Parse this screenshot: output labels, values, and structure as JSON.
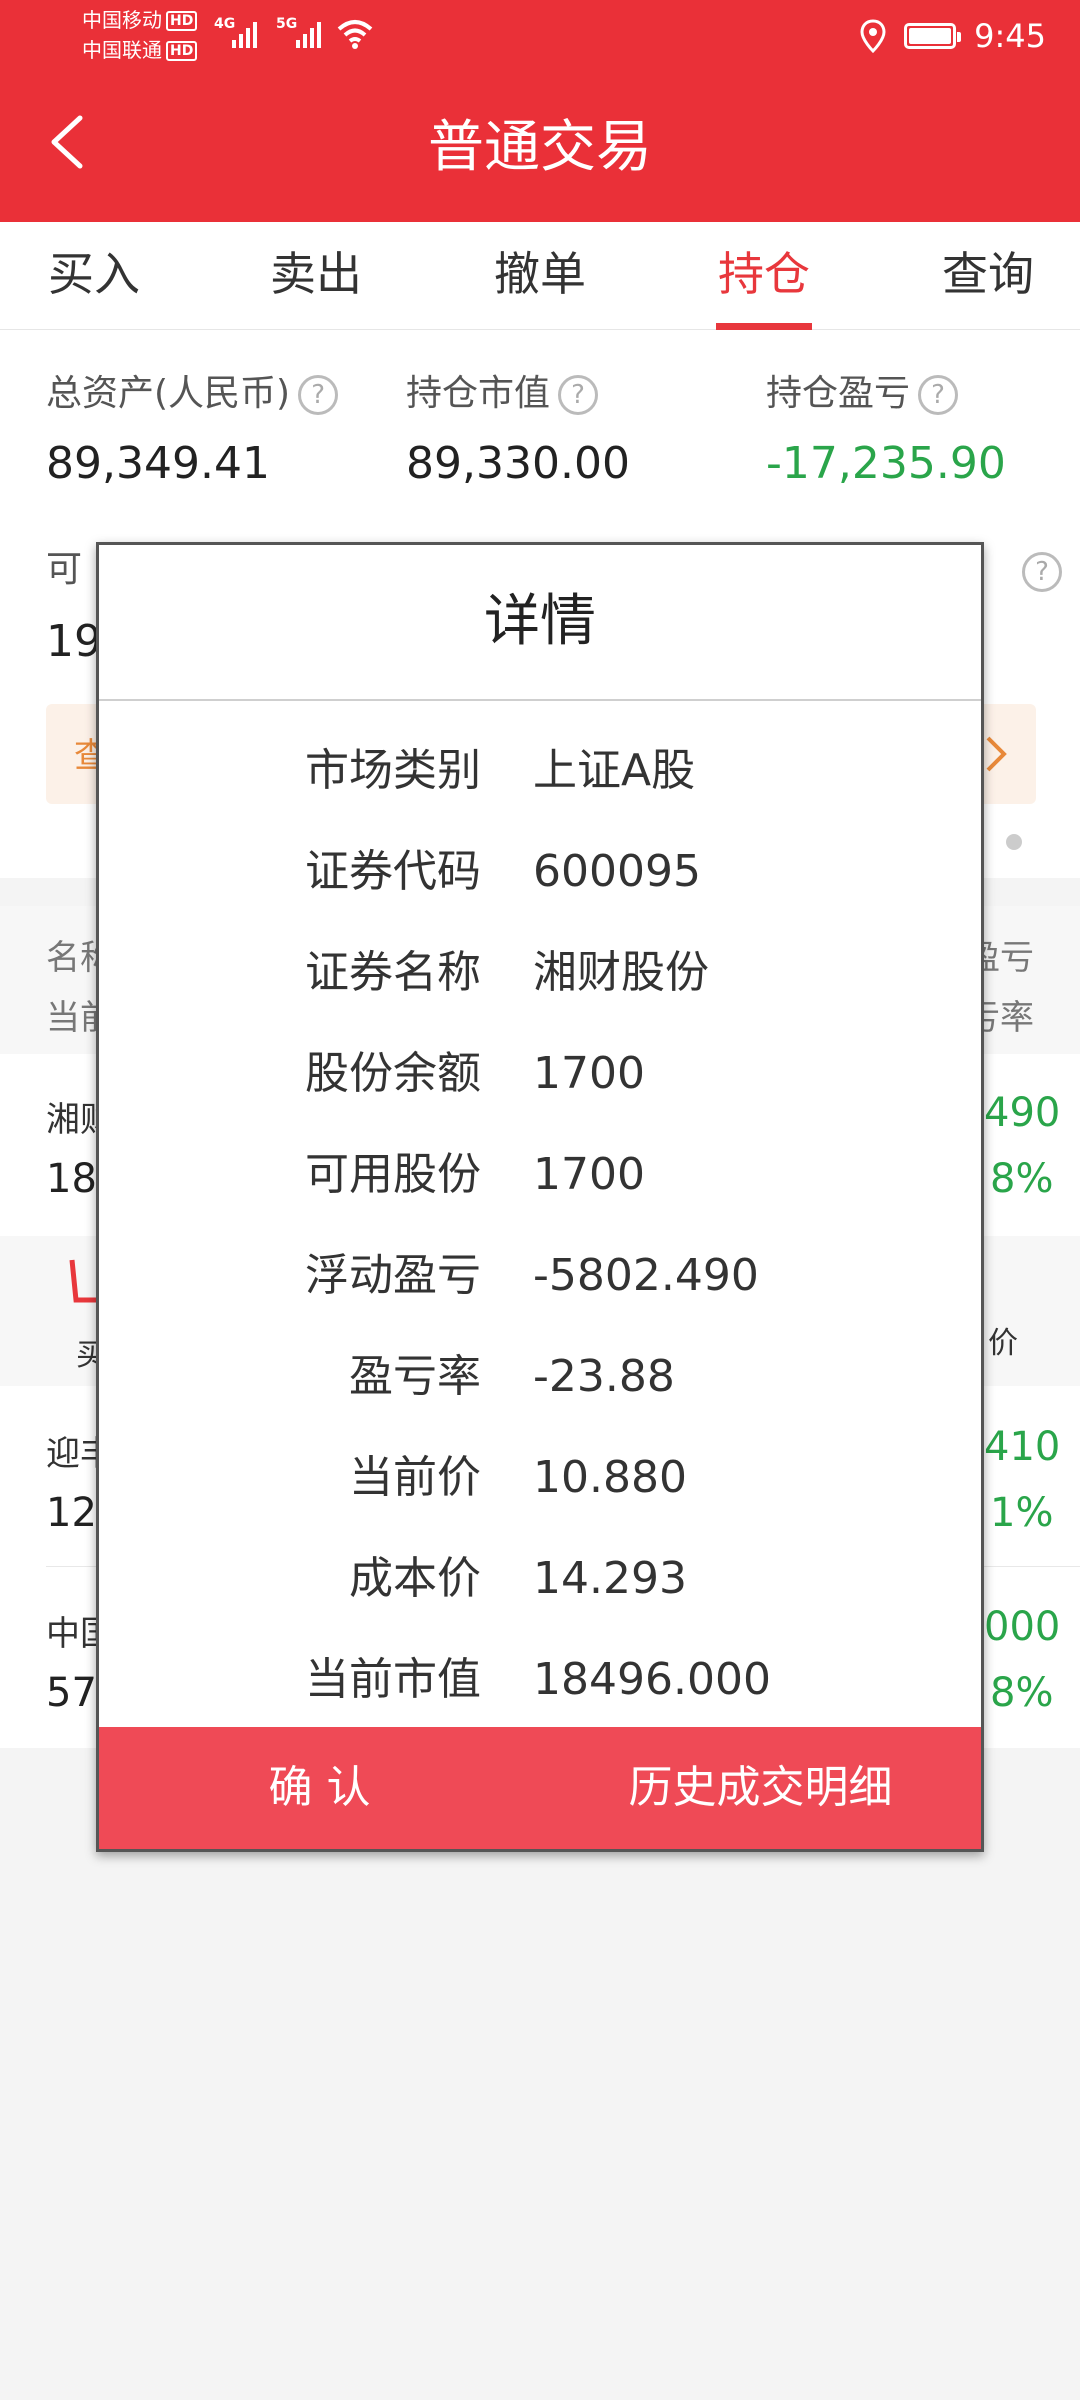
{
  "status_bar": {
    "carrier1": "中国移动",
    "carrier2": "中国联通",
    "hd": "HD",
    "net1": "4G",
    "net2": "5G",
    "time": "9:45"
  },
  "header": {
    "title": "普通交易"
  },
  "tabs": [
    {
      "label": "买入"
    },
    {
      "label": "卖出"
    },
    {
      "label": "撤单"
    },
    {
      "label": "持仓"
    },
    {
      "label": "查询"
    }
  ],
  "summary": {
    "total_assets_label": "总资产(人民币)",
    "total_assets_value": "89,349.41",
    "market_value_label": "持仓市值",
    "market_value_value": "89,330.00",
    "pnl_label": "持仓盈亏",
    "pnl_value": "-17,235.90",
    "available_label_partial": "可",
    "available_value_partial": "19",
    "banner_partial": "查"
  },
  "list": {
    "header_name": "名称",
    "header_price": "当前",
    "header_pnl": "盈亏",
    "header_rate": "亏率",
    "rows": [
      {
        "name": "湘财",
        "sub": "18,",
        "pnl": "490",
        "rate": "8%"
      },
      {
        "name": "迎丰",
        "sub": "12,",
        "pnl": "410",
        "rate": "1%"
      },
      {
        "name": "中国",
        "sub": "57,",
        "pnl": "000",
        "rate": "8%"
      }
    ],
    "action_left": "买",
    "action_right": "价"
  },
  "dialog": {
    "title": "详情",
    "rows": [
      {
        "label": "市场类别",
        "value": "上证A股"
      },
      {
        "label": "证券代码",
        "value": "600095"
      },
      {
        "label": "证券名称",
        "value": "湘财股份"
      },
      {
        "label": "股份余额",
        "value": "1700"
      },
      {
        "label": "可用股份",
        "value": "1700"
      },
      {
        "label": "浮动盈亏",
        "value": "-5802.490"
      },
      {
        "label": "盈亏率",
        "value": "-23.88"
      },
      {
        "label": "当前价",
        "value": "10.880"
      },
      {
        "label": "成本价",
        "value": "14.293"
      },
      {
        "label": "当前市值",
        "value": "18496.000"
      }
    ],
    "confirm_label": "确 认",
    "history_label": "历史成交明细"
  },
  "colors": {
    "brand_red": "#ea3038",
    "profit_green": "#2aa54a",
    "dialog_button": "#ef4a56"
  }
}
